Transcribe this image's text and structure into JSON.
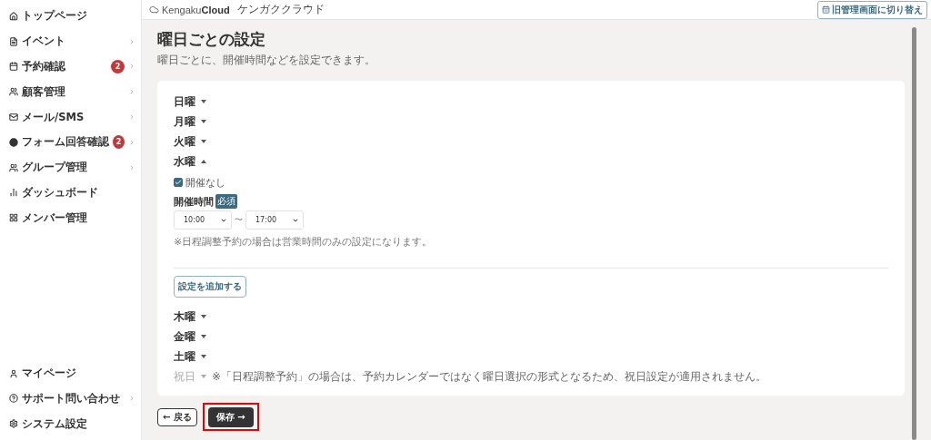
{
  "sidebar": {
    "items": [
      {
        "label": "トップページ",
        "has_submenu": false
      },
      {
        "label": "イベント",
        "has_submenu": true
      },
      {
        "label": "予約確認",
        "badge": "2",
        "has_submenu": true
      },
      {
        "label": "顧客管理",
        "has_submenu": true
      },
      {
        "label": "メール/SMS",
        "has_submenu": true
      },
      {
        "label": "フォーム回答確認",
        "badge": "2",
        "has_submenu": true
      },
      {
        "label": "グループ管理",
        "has_submenu": true
      },
      {
        "label": "ダッシュボード",
        "has_submenu": false
      },
      {
        "label": "メンバー管理",
        "has_submenu": false
      }
    ],
    "bottom_items": [
      {
        "label": "マイページ",
        "has_submenu": false
      },
      {
        "label": "サポート問い合わせ",
        "has_submenu": true
      },
      {
        "label": "システム設定",
        "has_submenu": false
      }
    ]
  },
  "header": {
    "logo_text": "Kengaku",
    "logo_bold": "Cloud",
    "logo_kana": "ケンガククラウド",
    "switch_button": "旧管理画面に切り替え"
  },
  "page": {
    "title": "曜日ごとの設定",
    "subtitle": "曜日ごとに、開催時間などを設定できます。"
  },
  "days": [
    {
      "label": "日曜",
      "expanded": false,
      "disabled": false
    },
    {
      "label": "月曜",
      "expanded": false,
      "disabled": false
    },
    {
      "label": "火曜",
      "expanded": false,
      "disabled": false
    },
    {
      "label": "水曜",
      "expanded": true,
      "disabled": false,
      "closed_checkbox": {
        "label": "開催なし",
        "checked": true
      },
      "time_label": "開催時間",
      "required_badge": "必須",
      "start_time": "10:00",
      "separator": "〜",
      "end_time": "17:00",
      "note": "※日程調整予約の場合は営業時間のみの設定になります。",
      "add_button": "設定を追加する"
    },
    {
      "label": "木曜",
      "expanded": false,
      "disabled": false
    },
    {
      "label": "金曜",
      "expanded": false,
      "disabled": false
    },
    {
      "label": "土曜",
      "expanded": false,
      "disabled": false
    },
    {
      "label": "祝日",
      "expanded": false,
      "disabled": true,
      "note": "※「日程調整予約」の場合は、予約カレンダーではなく曜日選択の形式となるため、祝日設定が適用されません。"
    }
  ],
  "footer": {
    "back_button": "← 戻る",
    "save_button": "保存 →",
    "save_highlighted": true
  }
}
